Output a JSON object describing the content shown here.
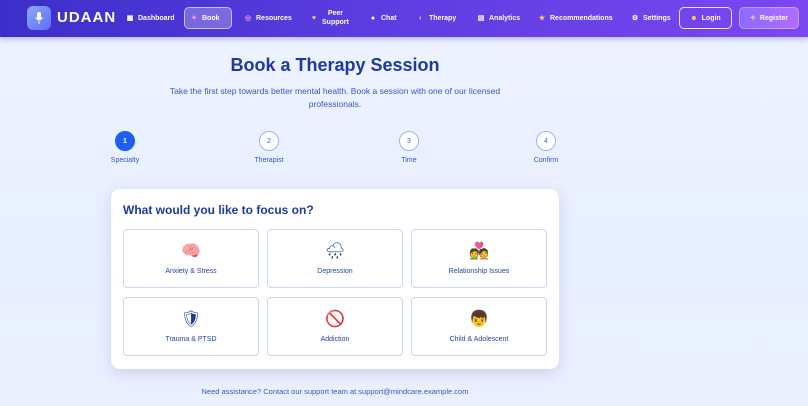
{
  "brand": {
    "name": "UDAAN",
    "logo_icon": "microphone-icon"
  },
  "nav": {
    "items": [
      {
        "label": "Dashboard",
        "icon": "dashboard-icon",
        "glyph": "▦"
      },
      {
        "label": "Book",
        "icon": "book-icon",
        "glyph": "✦",
        "active": true
      },
      {
        "label": "Resources",
        "icon": "resources-icon",
        "glyph": "◎"
      },
      {
        "label": "Peer Support",
        "line1": "Peer",
        "line2": "Support",
        "icon": "heart-icon",
        "glyph": "♥"
      },
      {
        "label": "Chat",
        "icon": "chat-icon",
        "glyph": "●"
      },
      {
        "label": "Therapy",
        "icon": "brain-icon",
        "glyph": "◐"
      },
      {
        "label": "Analytics",
        "icon": "chart-icon",
        "glyph": "▤"
      },
      {
        "label": "Recommendations",
        "icon": "star-icon",
        "glyph": "★"
      },
      {
        "label": "Settings",
        "icon": "gear-icon",
        "glyph": "⚙"
      }
    ],
    "login": {
      "label": "Login",
      "glyph": "☻"
    },
    "register": {
      "label": "Register",
      "glyph": "✧"
    }
  },
  "main": {
    "title": "Book a Therapy Session",
    "subtitle": "Take the first step towards better mental health. Book a session with one of our licensed professionals.",
    "steps": [
      {
        "num": "1",
        "label": "Specialty",
        "active": true
      },
      {
        "num": "2",
        "label": "Therapist"
      },
      {
        "num": "3",
        "label": "Time"
      },
      {
        "num": "4",
        "label": "Confirm"
      }
    ],
    "question": "What would you like to focus on?",
    "options": [
      {
        "label": "Anxiety & Stress",
        "emoji": "🧠",
        "icon": "brain-icon"
      },
      {
        "label": "Depression",
        "emoji": "🌧",
        "icon": "rain-cloud-icon"
      },
      {
        "label": "Relationship Issues",
        "emoji": "💑",
        "icon": "couple-icon"
      },
      {
        "label": "Trauma & PTSD",
        "emoji": "🛡",
        "icon": "shield-icon"
      },
      {
        "label": "Addiction",
        "emoji": "🚫",
        "icon": "prohibited-icon"
      },
      {
        "label": "Child & Adolescent",
        "emoji": "👦",
        "icon": "child-icon"
      }
    ],
    "footer": "Need assistance? Contact our support team at support@mindcare.example.com"
  },
  "colors": {
    "accent": "#1f5ff0",
    "nav_start": "#3b2fc9",
    "nav_end": "#7b47f0",
    "heading": "#1e3a9e"
  }
}
